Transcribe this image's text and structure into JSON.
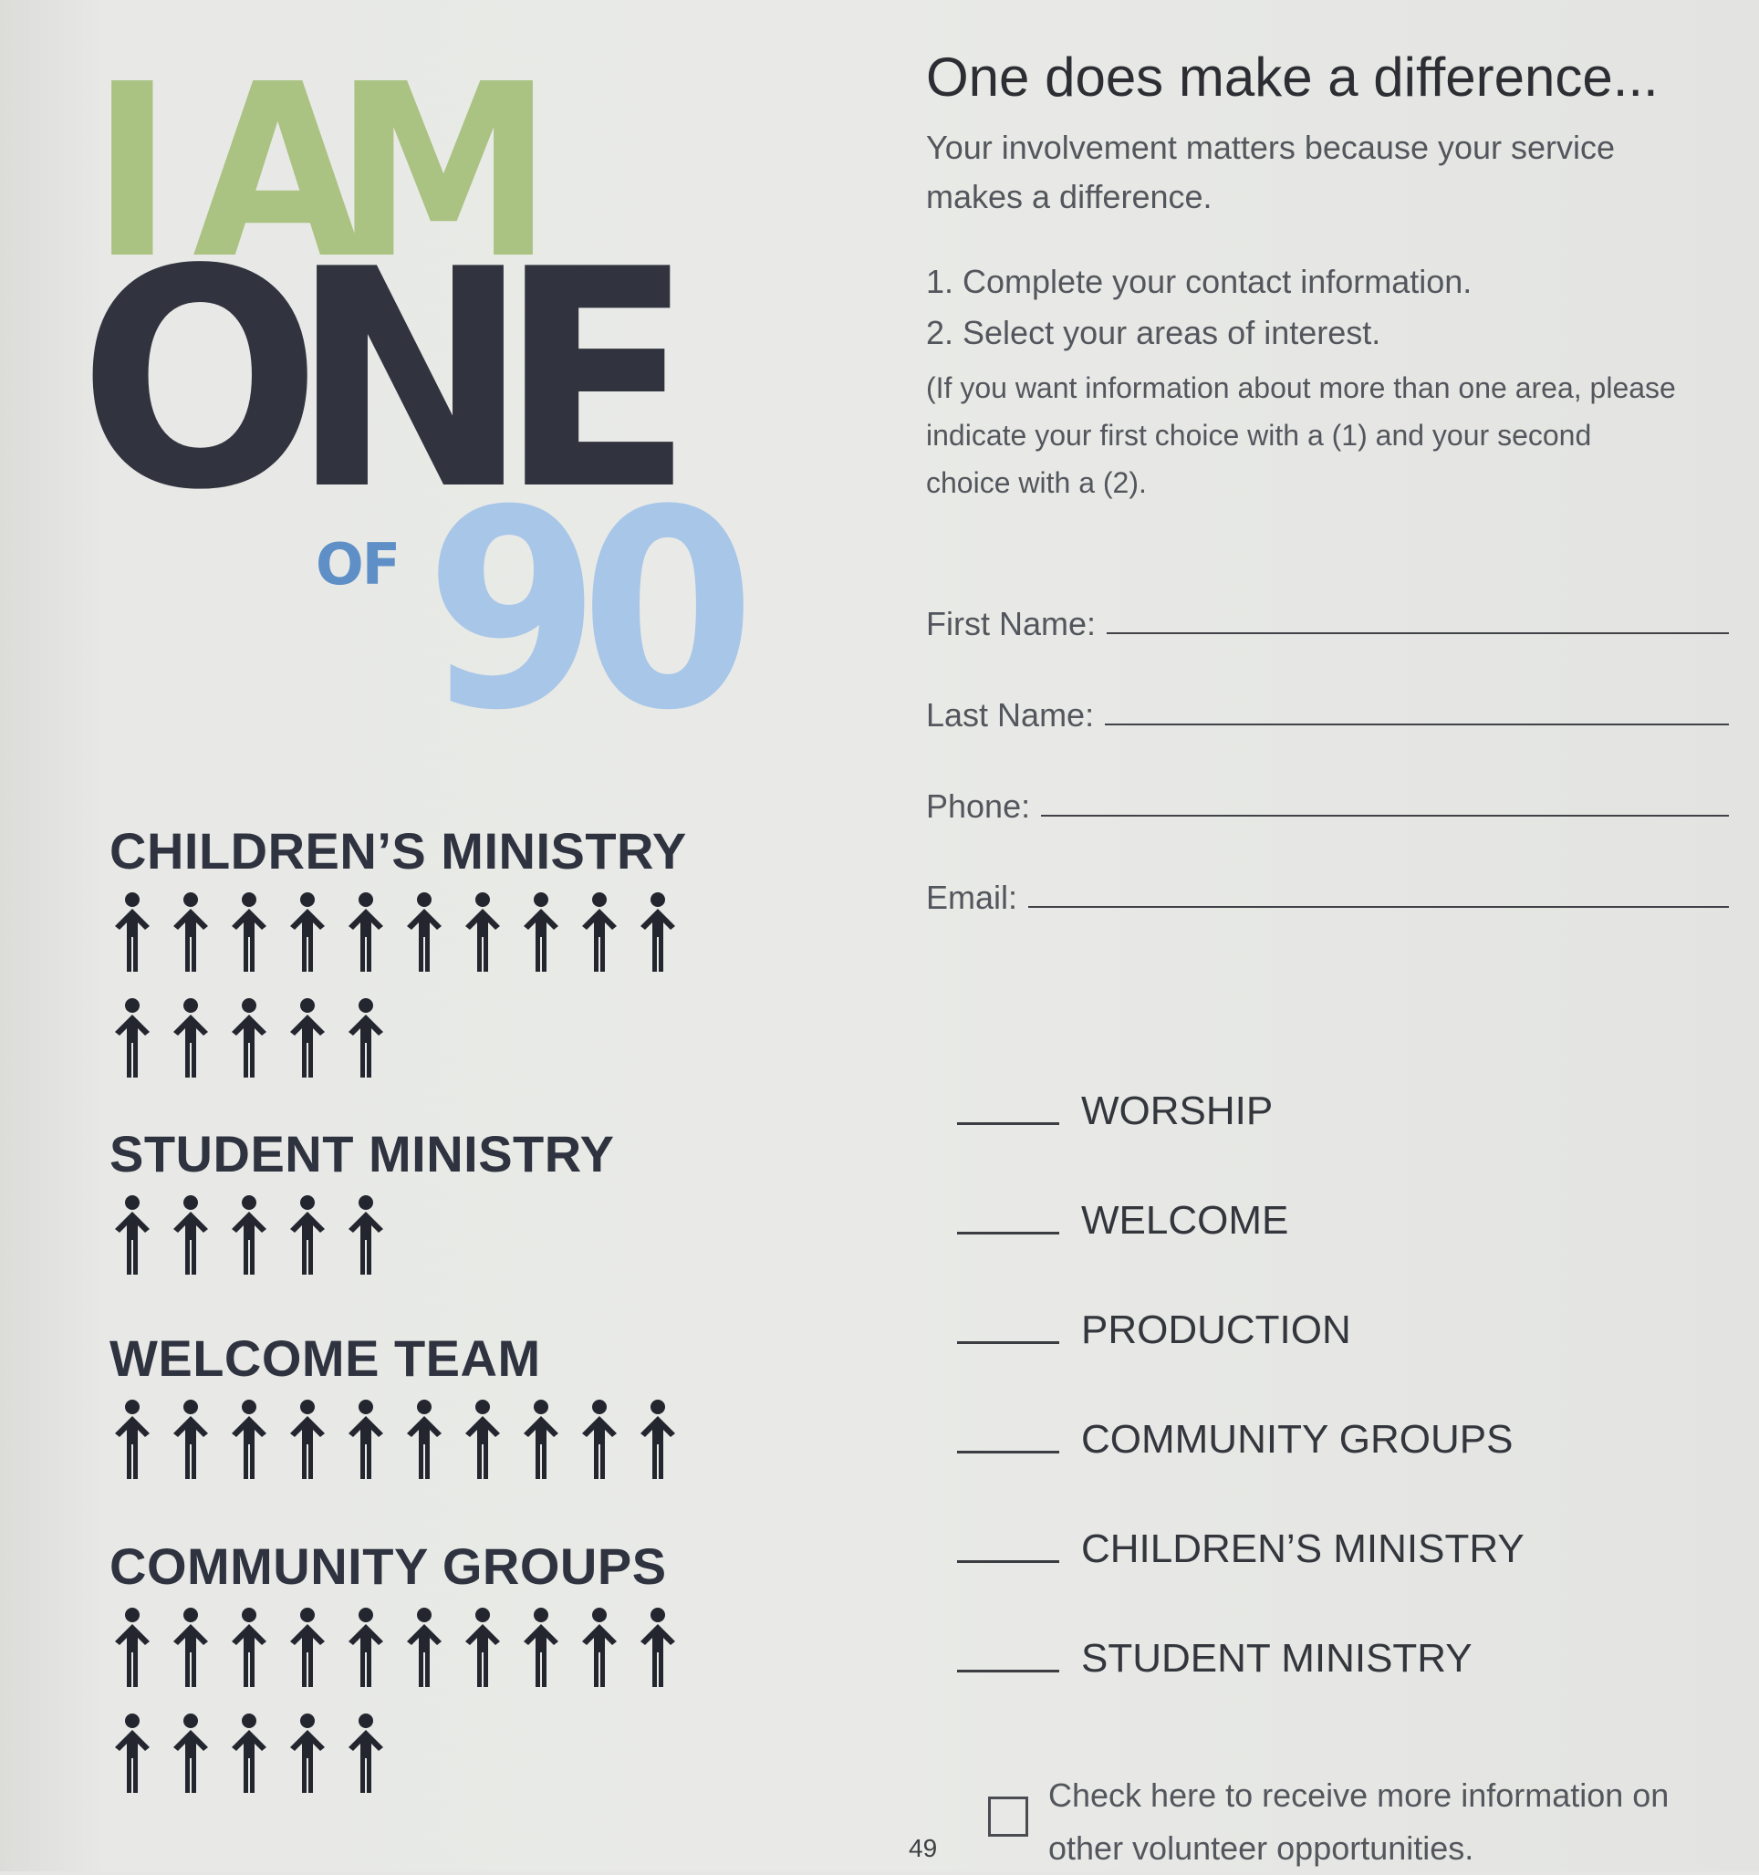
{
  "hero": {
    "line1": "I AM",
    "line2": "ONE",
    "of": "OF",
    "number": "90"
  },
  "ministries": [
    {
      "title": "CHILDREN’S MINISTRY",
      "count": 15
    },
    {
      "title": "STUDENT MINISTRY",
      "count": 5
    },
    {
      "title": "WELCOME TEAM",
      "count": 10
    },
    {
      "title": "COMMUNITY GROUPS",
      "count": 15
    }
  ],
  "form": {
    "heading": "One does make a difference...",
    "intro": "Your involvement matters because your service makes a difference.",
    "steps": [
      "1. Complete your contact information.",
      "2. Select your areas of interest."
    ],
    "note": "(If you want information about more than one area, please indicate your first choice with a (1) and your second choice with a (2).",
    "fields": [
      {
        "label": "First Name:",
        "value": ""
      },
      {
        "label": "Last Name:",
        "value": ""
      },
      {
        "label": "Phone:",
        "value": ""
      },
      {
        "label": "Email:",
        "value": ""
      }
    ],
    "interests": [
      "WORSHIP",
      "WELCOME",
      "PRODUCTION",
      "COMMUNITY GROUPS",
      "CHILDREN’S MINISTRY",
      "STUDENT MINISTRY"
    ],
    "checkbox_label": "Check here to receive more information on other volunteer opportunities.",
    "checkbox_checked": false
  },
  "page_number": "49",
  "colors": {
    "am_green": "#aac282",
    "one_navy": "#31343f",
    "of_blue": "#5e8fc6",
    "ninety_lightblue": "#a8c6e8"
  },
  "icons": {
    "person": "person-icon"
  }
}
